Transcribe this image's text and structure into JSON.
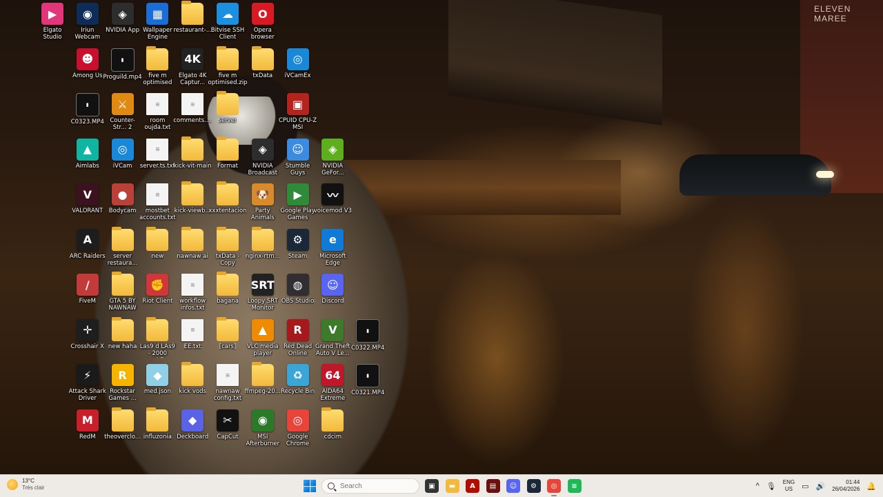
{
  "desktop": {
    "icons": [
      {
        "label": "Elgato Studio",
        "glyph": "▶",
        "color": "#e2367a",
        "col": 0,
        "row": 0,
        "type": "app"
      },
      {
        "label": "Iriun Webcam",
        "glyph": "◉",
        "color": "#0d2c57",
        "col": 1,
        "row": 0,
        "type": "app"
      },
      {
        "label": "NVIDIA App",
        "glyph": "◈",
        "color": "#2d2d2d",
        "col": 2,
        "row": 0,
        "type": "app"
      },
      {
        "label": "Wallpaper Engine",
        "glyph": "▦",
        "color": "#1c6cd6",
        "col": 3,
        "row": 0,
        "type": "app"
      },
      {
        "label": "restaurant-...",
        "glyph": "",
        "color": "",
        "col": 4,
        "row": 0,
        "type": "folder"
      },
      {
        "label": "Bitvise SSH Client",
        "glyph": "☁",
        "color": "#1d8fe0",
        "col": 5,
        "row": 0,
        "type": "app"
      },
      {
        "label": "Opera browser",
        "glyph": "O",
        "color": "#d91a25",
        "col": 6,
        "row": 0,
        "type": "app"
      },
      {
        "label": "Among Us",
        "glyph": "☻",
        "color": "#c8102e",
        "col": 1,
        "row": 1,
        "type": "app"
      },
      {
        "label": "Proguild.mp4",
        "glyph": "▮",
        "color": "",
        "col": 2,
        "row": 1,
        "type": "video"
      },
      {
        "label": "five m optimised",
        "glyph": "",
        "color": "",
        "col": 3,
        "row": 1,
        "type": "folder"
      },
      {
        "label": "Elgato 4K Captur...",
        "glyph": "4K",
        "color": "#222",
        "col": 4,
        "row": 1,
        "type": "app"
      },
      {
        "label": "five m optimised.zip",
        "glyph": "",
        "color": "",
        "col": 5,
        "row": 1,
        "type": "folder"
      },
      {
        "label": "txData",
        "glyph": "",
        "color": "",
        "col": 6,
        "row": 1,
        "type": "folder"
      },
      {
        "label": "iVCamEx",
        "glyph": "◎",
        "color": "#1a88d8",
        "col": 7,
        "row": 1,
        "type": "app"
      },
      {
        "label": "C0323.MP4",
        "glyph": "▮",
        "color": "",
        "col": 1,
        "row": 2,
        "type": "video"
      },
      {
        "label": "Counter-Str... 2",
        "glyph": "⚔",
        "color": "#e08a14",
        "col": 2,
        "row": 2,
        "type": "app"
      },
      {
        "label": "room oujda.txt",
        "glyph": "≡",
        "color": "",
        "col": 3,
        "row": 2,
        "type": "file"
      },
      {
        "label": "comments....",
        "glyph": "≡",
        "color": "",
        "col": 4,
        "row": 2,
        "type": "file"
      },
      {
        "label": "server",
        "glyph": "",
        "color": "",
        "col": 5,
        "row": 2,
        "type": "folder"
      },
      {
        "label": "CPUID CPU-Z MSI",
        "glyph": "▣",
        "color": "#b5231f",
        "col": 7,
        "row": 2,
        "type": "app"
      },
      {
        "label": "Aimlabs",
        "glyph": "▲",
        "color": "#0fb5a3",
        "col": 1,
        "row": 3,
        "type": "app"
      },
      {
        "label": "iVCam",
        "glyph": "◎",
        "color": "#1a88d8",
        "col": 2,
        "row": 3,
        "type": "app"
      },
      {
        "label": "server.ts.txt",
        "glyph": "≡",
        "color": "",
        "col": 3,
        "row": 3,
        "type": "file"
      },
      {
        "label": "kick-vit-main",
        "glyph": "",
        "color": "",
        "col": 4,
        "row": 3,
        "type": "folder"
      },
      {
        "label": "Format",
        "glyph": "",
        "color": "",
        "col": 5,
        "row": 3,
        "type": "folder"
      },
      {
        "label": "NVIDIA Broadcast",
        "glyph": "◈",
        "color": "#2d2d2d",
        "col": 6,
        "row": 3,
        "type": "app"
      },
      {
        "label": "Stumble Guys",
        "glyph": "☺",
        "color": "#3b8be0",
        "col": 7,
        "row": 3,
        "type": "app"
      },
      {
        "label": "NVIDIA GeFor...",
        "glyph": "◈",
        "color": "#5fae1e",
        "col": 8,
        "row": 3,
        "type": "app"
      },
      {
        "label": "VALORANT",
        "glyph": "V",
        "color": "#3a1220",
        "col": 1,
        "row": 4,
        "type": "app"
      },
      {
        "label": "Bodycam",
        "glyph": "●",
        "color": "#b9413a",
        "col": 2,
        "row": 4,
        "type": "app"
      },
      {
        "label": "mostbet accounts.txt",
        "glyph": "≡",
        "color": "",
        "col": 3,
        "row": 4,
        "type": "file"
      },
      {
        "label": "kick-viewb...",
        "glyph": "",
        "color": "",
        "col": 4,
        "row": 4,
        "type": "folder"
      },
      {
        "label": "xxxtentacion",
        "glyph": "",
        "color": "",
        "col": 5,
        "row": 4,
        "type": "folder"
      },
      {
        "label": "Party Animals",
        "glyph": "🐶",
        "color": "#d98a2a",
        "col": 6,
        "row": 4,
        "type": "app"
      },
      {
        "label": "Google Play Games",
        "glyph": "▶",
        "color": "#2f8a3a",
        "col": 7,
        "row": 4,
        "type": "app"
      },
      {
        "label": "voicemod V3",
        "glyph": "〰",
        "color": "#111",
        "col": 8,
        "row": 4,
        "type": "app"
      },
      {
        "label": "ARC Raiders",
        "glyph": "A",
        "color": "#1d1d1d",
        "col": 1,
        "row": 5,
        "type": "app"
      },
      {
        "label": "server restaura...",
        "glyph": "",
        "color": "",
        "col": 2,
        "row": 5,
        "type": "folder"
      },
      {
        "label": "new",
        "glyph": "",
        "color": "",
        "col": 3,
        "row": 5,
        "type": "folder"
      },
      {
        "label": "nawnaw ai",
        "glyph": "",
        "color": "",
        "col": 4,
        "row": 5,
        "type": "folder"
      },
      {
        "label": "txData - Copy",
        "glyph": "",
        "color": "",
        "col": 5,
        "row": 5,
        "type": "folder"
      },
      {
        "label": "nginx-rtm...",
        "glyph": "",
        "color": "",
        "col": 6,
        "row": 5,
        "type": "folder"
      },
      {
        "label": "Steam",
        "glyph": "⚙",
        "color": "#1b2838",
        "col": 7,
        "row": 5,
        "type": "app"
      },
      {
        "label": "Microsoft Edge",
        "glyph": "e",
        "color": "#0f7bd6",
        "col": 8,
        "row": 5,
        "type": "app"
      },
      {
        "label": "FiveM",
        "glyph": "/",
        "color": "#c23a3a",
        "col": 1,
        "row": 6,
        "type": "app"
      },
      {
        "label": "GTA 5 BY NAWNAW",
        "glyph": "",
        "color": "",
        "col": 2,
        "row": 6,
        "type": "folder"
      },
      {
        "label": "Riot Client",
        "glyph": "✊",
        "color": "#d13639",
        "col": 3,
        "row": 6,
        "type": "app"
      },
      {
        "label": "workflow infos.txt",
        "glyph": "≡",
        "color": "",
        "col": 4,
        "row": 6,
        "type": "file"
      },
      {
        "label": "bagana",
        "glyph": "",
        "color": "",
        "col": 5,
        "row": 6,
        "type": "folder"
      },
      {
        "label": "Loopy SRT Monitor",
        "glyph": "SRT",
        "color": "#222",
        "col": 6,
        "row": 6,
        "type": "app"
      },
      {
        "label": "OBS Studio",
        "glyph": "◍",
        "color": "#302e31",
        "col": 7,
        "row": 6,
        "type": "app"
      },
      {
        "label": "Discord",
        "glyph": "☺",
        "color": "#5865f2",
        "col": 8,
        "row": 6,
        "type": "app"
      },
      {
        "label": "Crosshair X",
        "glyph": "✛",
        "color": "#1e1e1e",
        "col": 1,
        "row": 7,
        "type": "app"
      },
      {
        "label": "new haha",
        "glyph": "",
        "color": "",
        "col": 2,
        "row": 7,
        "type": "folder"
      },
      {
        "label": "Las9 d LAs9 - 2000 workfl...",
        "glyph": "",
        "color": "",
        "col": 3,
        "row": 7,
        "type": "folder"
      },
      {
        "label": "EE.txt",
        "glyph": "≡",
        "color": "",
        "col": 4,
        "row": 7,
        "type": "file"
      },
      {
        "label": "[cars]",
        "glyph": "",
        "color": "",
        "col": 5,
        "row": 7,
        "type": "folder"
      },
      {
        "label": "VLC media player",
        "glyph": "▲",
        "color": "#f08a00",
        "col": 6,
        "row": 7,
        "type": "app"
      },
      {
        "label": "Red Dead Online",
        "glyph": "R",
        "color": "#a5191d",
        "col": 7,
        "row": 7,
        "type": "app"
      },
      {
        "label": "Grand Theft Auto V Le...",
        "glyph": "V",
        "color": "#3d7a2a",
        "col": 8,
        "row": 7,
        "type": "app"
      },
      {
        "label": "C0322.MP4",
        "glyph": "▮",
        "color": "",
        "col": 9,
        "row": 7,
        "type": "video"
      },
      {
        "label": "Attack Shark Driver",
        "glyph": "⚡",
        "color": "#1a1a1a",
        "col": 1,
        "row": 8,
        "type": "app"
      },
      {
        "label": "Rockstar Games ...",
        "glyph": "R",
        "color": "#f4b400",
        "col": 2,
        "row": 8,
        "type": "app"
      },
      {
        "label": "med.json",
        "glyph": "◆",
        "color": "#8fd0e6",
        "col": 3,
        "row": 8,
        "type": "app"
      },
      {
        "label": "kick vods",
        "glyph": "",
        "color": "",
        "col": 4,
        "row": 8,
        "type": "folder"
      },
      {
        "label": "nawnaw config.txt",
        "glyph": "≡",
        "color": "",
        "col": 5,
        "row": 8,
        "type": "file"
      },
      {
        "label": "ffmpeg-20...",
        "glyph": "",
        "color": "",
        "col": 6,
        "row": 8,
        "type": "folder"
      },
      {
        "label": "Recycle Bin",
        "glyph": "♻",
        "color": "#3aa6d8",
        "col": 7,
        "row": 8,
        "type": "app"
      },
      {
        "label": "AIDA64 Extreme",
        "glyph": "64",
        "color": "#c0172b",
        "col": 8,
        "row": 8,
        "type": "app"
      },
      {
        "label": "C0321.MP4",
        "glyph": "▮",
        "color": "",
        "col": 9,
        "row": 8,
        "type": "video"
      },
      {
        "label": "RedM",
        "glyph": "M",
        "color": "#c91f2b",
        "col": 1,
        "row": 9,
        "type": "app"
      },
      {
        "label": "theoverclo...",
        "glyph": "",
        "color": "",
        "col": 2,
        "row": 9,
        "type": "folder"
      },
      {
        "label": "influzonia",
        "glyph": "",
        "color": "",
        "col": 3,
        "row": 9,
        "type": "folder"
      },
      {
        "label": "Deckboard",
        "glyph": "◆",
        "color": "#5a62e6",
        "col": 4,
        "row": 9,
        "type": "app"
      },
      {
        "label": "CapCut",
        "glyph": "✂",
        "color": "#111",
        "col": 5,
        "row": 9,
        "type": "app"
      },
      {
        "label": "MSI Afterburner",
        "glyph": "◉",
        "color": "#2a7a2a",
        "col": 6,
        "row": 9,
        "type": "app"
      },
      {
        "label": "Google Chrome",
        "glyph": "◎",
        "color": "#e9443a",
        "col": 7,
        "row": 9,
        "type": "app"
      },
      {
        "label": "cdcim",
        "glyph": "",
        "color": "",
        "col": 8,
        "row": 9,
        "type": "folder"
      }
    ]
  },
  "wallpaper": {
    "sign_text": "ELEVEN MAREE"
  },
  "taskbar": {
    "weather": {
      "temp": "13°C",
      "condition": "Très clair"
    },
    "search": {
      "placeholder": "Search"
    },
    "apps": [
      {
        "name": "task-view",
        "glyph": "▣",
        "color": "#333"
      },
      {
        "name": "file-explorer",
        "glyph": "▬",
        "color": "#f2b93b"
      },
      {
        "name": "acrobat",
        "glyph": "A",
        "color": "#b30b00"
      },
      {
        "name": "obs-task",
        "glyph": "▤",
        "color": "#6b0f0f"
      },
      {
        "name": "discord",
        "glyph": "☺",
        "color": "#5865f2"
      },
      {
        "name": "steam",
        "glyph": "⚙",
        "color": "#1b2838"
      },
      {
        "name": "chrome",
        "glyph": "◎",
        "color": "#e9443a"
      },
      {
        "name": "spotify",
        "glyph": "≋",
        "color": "#1db954"
      }
    ],
    "tray": {
      "lang_top": "ENG",
      "lang_bottom": "US",
      "time": "01:44",
      "date": "26/04/2026"
    }
  }
}
